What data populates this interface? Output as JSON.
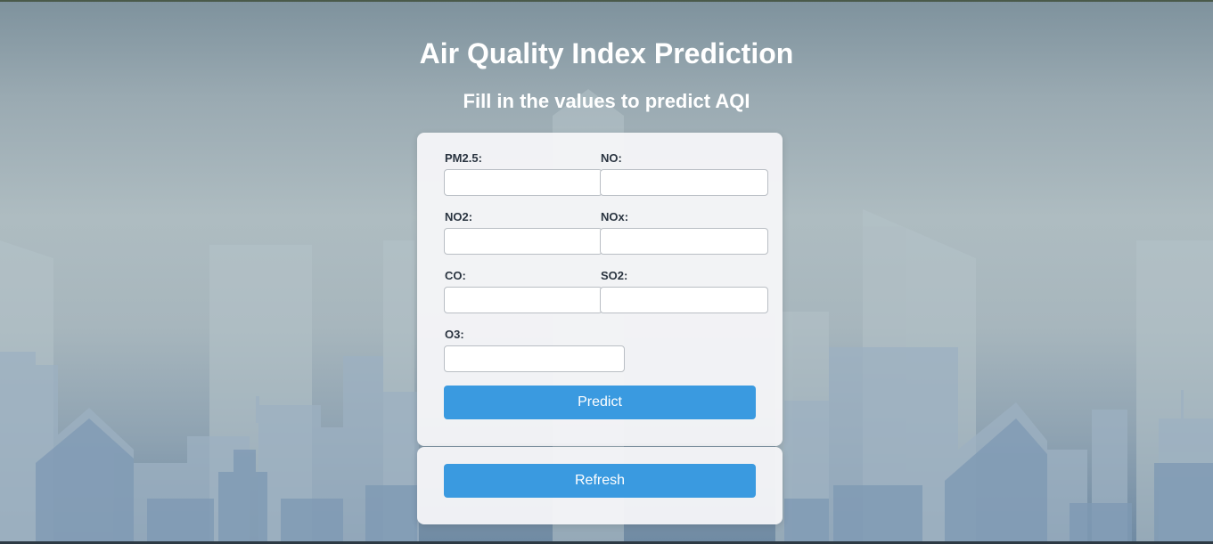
{
  "header": {
    "title": "Air Quality Index Prediction",
    "subtitle": "Fill in the values to predict AQI"
  },
  "form": {
    "fields": [
      {
        "label": "PM2.5:",
        "value": ""
      },
      {
        "label": "NO:",
        "value": ""
      },
      {
        "label": "NO2:",
        "value": ""
      },
      {
        "label": "NOx:",
        "value": ""
      },
      {
        "label": "CO:",
        "value": ""
      },
      {
        "label": "SO2:",
        "value": ""
      },
      {
        "label": "O3:",
        "value": ""
      }
    ],
    "predict_label": "Predict"
  },
  "refresh": {
    "label": "Refresh"
  },
  "colors": {
    "accent": "#3a9ae0",
    "card": "#f5f6f8",
    "label": "#2a3440"
  }
}
